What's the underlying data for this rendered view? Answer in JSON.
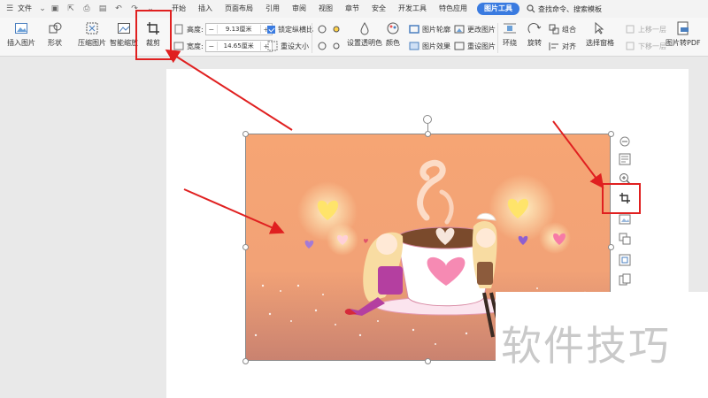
{
  "menu": {
    "file_label": "文件",
    "tabs": [
      "开始",
      "插入",
      "页面布局",
      "引用",
      "审阅",
      "视图",
      "章节",
      "安全",
      "开发工具",
      "特色应用"
    ],
    "active_tab": "图片工具",
    "search_label": "查找命令、搜索模板"
  },
  "ribbon": {
    "insert_picture": "插入图片",
    "shape": "形状",
    "compress_picture": "压缩图片",
    "smart_zoom": "智能缩放",
    "crop": "裁剪",
    "height_label": "高度:",
    "height_value": "9.13厘米",
    "width_label": "宽度:",
    "width_value": "14.65厘米",
    "lock_ratio": "锁定纵横比",
    "reset_size": "重设大小",
    "set_transparent": "设置透明色",
    "color": "颜色",
    "picture_outline": "图片轮廓",
    "picture_effects": "图片效果",
    "change_picture": "更改图片",
    "reset_picture": "重设图片",
    "wrap": "环绕",
    "rotate": "旋转",
    "group": "组合",
    "align": "对齐",
    "bring_forward": "上移一层",
    "send_backward": "下移一层",
    "selection_pane": "选择窗格",
    "picture_to_pdf": "图片转PDF"
  },
  "colors": {
    "accent": "#3a7be0",
    "highlight": "#e02020",
    "picture_bg": "#f5a87a"
  },
  "watermark": "软件技巧"
}
